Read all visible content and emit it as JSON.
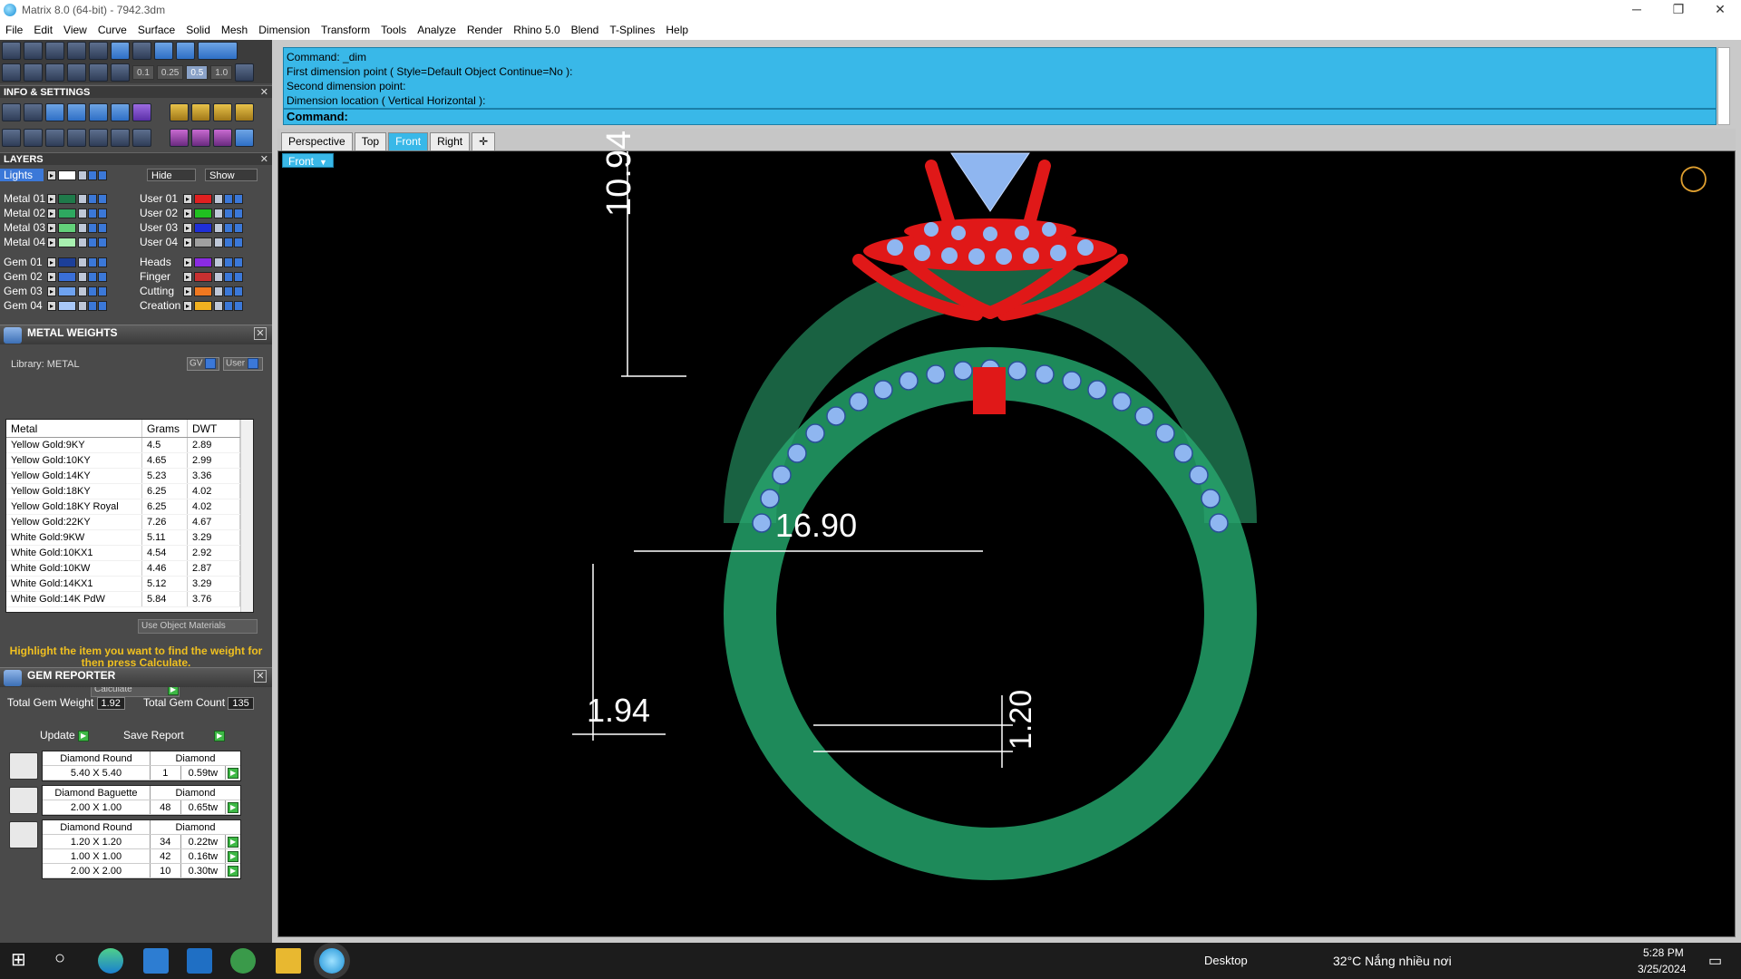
{
  "window": {
    "title": "Matrix 8.0 (64-bit) - 7942.3dm"
  },
  "menu": [
    "File",
    "Edit",
    "View",
    "Curve",
    "Surface",
    "Solid",
    "Mesh",
    "Dimension",
    "Transform",
    "Tools",
    "Analyze",
    "Render",
    "Rhino 5.0",
    "Blend",
    "T-Splines",
    "Help"
  ],
  "toolbar": {
    "snaps": [
      "0.1",
      "0.25",
      "0.5",
      "1.0"
    ]
  },
  "info_settings": {
    "title": "INFO & SETTINGS"
  },
  "layers": {
    "title": "LAYERS",
    "lights_label": "Lights",
    "hide_label": "Hide",
    "show_label": "Show",
    "left": [
      {
        "name": "Metal 01",
        "color": "#1f7a4a"
      },
      {
        "name": "Metal 02",
        "color": "#2ea860"
      },
      {
        "name": "Metal 03",
        "color": "#63d17a"
      },
      {
        "name": "Metal 04",
        "color": "#a8f0b0"
      },
      {
        "name": "Gem 01",
        "color": "#1c3f99"
      },
      {
        "name": "Gem 02",
        "color": "#3a6fd8"
      },
      {
        "name": "Gem 03",
        "color": "#6ea2ef"
      },
      {
        "name": "Gem 04",
        "color": "#a8c8f8"
      }
    ],
    "right": [
      {
        "name": "User 01",
        "color": "#e02020"
      },
      {
        "name": "User 02",
        "color": "#20c020"
      },
      {
        "name": "User 03",
        "color": "#1f2fd8"
      },
      {
        "name": "User 04",
        "color": "#a0a0a0"
      },
      {
        "name": "Heads",
        "color": "#8a2be2"
      },
      {
        "name": "Finger",
        "color": "#c83030"
      },
      {
        "name": "Cutting",
        "color": "#f07820"
      },
      {
        "name": "Creation",
        "color": "#f0b020"
      }
    ]
  },
  "metal_weights": {
    "title": "METAL WEIGHTS",
    "library": "Library: METAL",
    "gv_label": "GV",
    "user_label": "User",
    "headers": [
      "Metal",
      "Grams",
      "DWT"
    ],
    "rows": [
      [
        "Yellow Gold:9KY",
        "4.5",
        "2.89"
      ],
      [
        "Yellow Gold:10KY",
        "4.65",
        "2.99"
      ],
      [
        "Yellow Gold:14KY",
        "5.23",
        "3.36"
      ],
      [
        "Yellow Gold:18KY",
        "6.25",
        "4.02"
      ],
      [
        "Yellow Gold:18KY Royal",
        "6.25",
        "4.02"
      ],
      [
        "Yellow Gold:22KY",
        "7.26",
        "4.67"
      ],
      [
        "White Gold:9KW",
        "5.11",
        "3.29"
      ],
      [
        "White Gold:10KX1",
        "4.54",
        "2.92"
      ],
      [
        "White Gold:10KW",
        "4.46",
        "2.87"
      ],
      [
        "White Gold:14KX1",
        "5.12",
        "3.29"
      ],
      [
        "White Gold:14K PdW",
        "5.84",
        "3.76"
      ]
    ],
    "use_object_materials": "Use Object Materials",
    "hint": "Highlight the item you want to find the weight for then press Calculate.",
    "calculate": "Calculate"
  },
  "gem_reporter": {
    "title": "GEM REPORTER",
    "total_weight_label": "Total Gem Weight",
    "total_weight": "1.92",
    "total_count_label": "Total Gem Count",
    "total_count": "135",
    "update": "Update",
    "save_report": "Save Report",
    "groups": [
      {
        "shape": "Diamond Round",
        "material": "Diamond",
        "rows": [
          [
            "5.40 X 5.40",
            "1",
            "0.59tw"
          ]
        ]
      },
      {
        "shape": "Diamond Baguette",
        "material": "Diamond",
        "rows": [
          [
            "2.00 X 1.00",
            "48",
            "0.65tw"
          ]
        ]
      },
      {
        "shape": "Diamond Round",
        "material": "Diamond",
        "rows": [
          [
            "1.20 X 1.20",
            "34",
            "0.22tw"
          ],
          [
            "1.00 X 1.00",
            "42",
            "0.16tw"
          ],
          [
            "2.00 X 2.00",
            "10",
            "0.30tw"
          ]
        ]
      }
    ]
  },
  "command": {
    "history": [
      "Command: _dim",
      "First dimension point ( Style=Default  Object  Continue=No ):",
      "Second dimension point:",
      "Dimension location ( Vertical  Horizontal ):"
    ],
    "prompt": "Command:"
  },
  "view_tabs": [
    "Perspective",
    "Top",
    "Front",
    "Right"
  ],
  "viewport": {
    "label": "Front",
    "dimensions": {
      "height": "10.94",
      "inner_diameter": "16.90",
      "shank_width": "1.94",
      "shank_thickness": "1.20"
    },
    "colors": {
      "metal": "#1e8a5a",
      "prongs": "#e01818",
      "gems": "#8fb6f0"
    }
  },
  "taskbar": {
    "desktop": "Desktop",
    "weather": "32°C  Nắng nhiều nơi",
    "time": "5:28 PM",
    "date": "3/25/2024"
  }
}
